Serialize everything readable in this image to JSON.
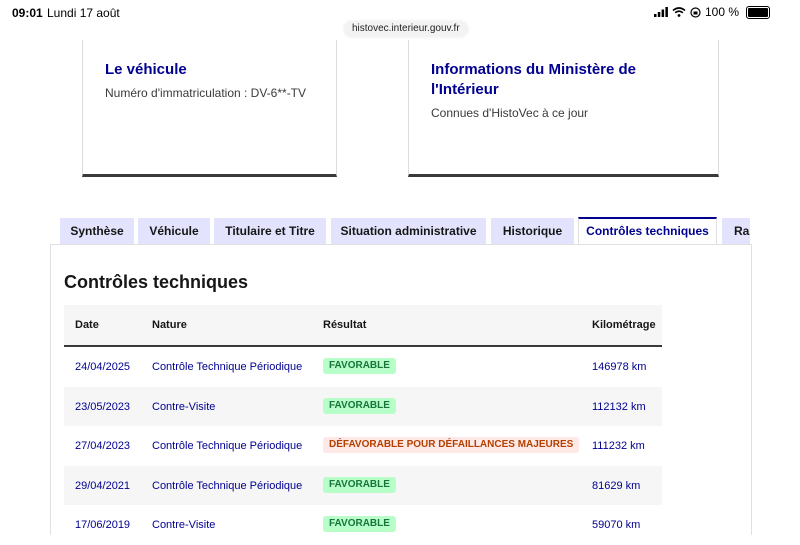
{
  "status_bar": {
    "time": "09:01",
    "date": "Lundi 17 août",
    "battery": "100 %"
  },
  "browser": {
    "url": "histovec.interieur.gouv.fr"
  },
  "cards": [
    {
      "title": "Le véhicule",
      "text": "Numéro d'immatriculation : DV-6**-TV"
    },
    {
      "title": "Informations du Ministère de l'Intérieur",
      "text": "Connues d'HistoVec à ce jour"
    }
  ],
  "tabs": [
    {
      "label": "Synthèse",
      "active": false
    },
    {
      "label": "Véhicule",
      "active": false
    },
    {
      "label": "Titulaire et Titre",
      "active": false
    },
    {
      "label": "Situation administrative",
      "active": false
    },
    {
      "label": "Historique",
      "active": false
    },
    {
      "label": "Contrôles techniques",
      "active": true
    },
    {
      "label": "Rapport",
      "active": false
    }
  ],
  "section": {
    "title": "Contrôles techniques",
    "columns": {
      "date": "Date",
      "nature": "Nature",
      "result": "Résultat",
      "mileage": "Kilométrage"
    },
    "rows": [
      {
        "date": "24/04/2025",
        "nature": "Contrôle Technique Périodique",
        "result": "FAVORABLE",
        "mileage": "146978 km"
      },
      {
        "date": "23/05/2023",
        "nature": "Contre-Visite",
        "result": "FAVORABLE",
        "mileage": "112132 km"
      },
      {
        "date": "27/04/2023",
        "nature": "Contrôle Technique Périodique",
        "result": "DÉFAVORABLE POUR DÉFAILLANCES MAJEURES",
        "mileage": "111232 km"
      },
      {
        "date": "29/04/2021",
        "nature": "Contrôle Technique Périodique",
        "result": "FAVORABLE",
        "mileage": "81629 km"
      },
      {
        "date": "17/06/2019",
        "nature": "Contre-Visite",
        "result": "FAVORABLE",
        "mileage": "59070 km"
      }
    ]
  },
  "colors": {
    "primary": "#000091",
    "tab_bg": "#e3e3fd",
    "favorable_bg": "#b8fec9",
    "favorable_text": "#18753c",
    "unfavorable_bg": "#ffe9e6",
    "unfavorable_text": "#b34000"
  },
  "icons": [
    "signal-icon",
    "wifi-icon",
    "orientation-lock-icon",
    "battery-icon"
  ]
}
